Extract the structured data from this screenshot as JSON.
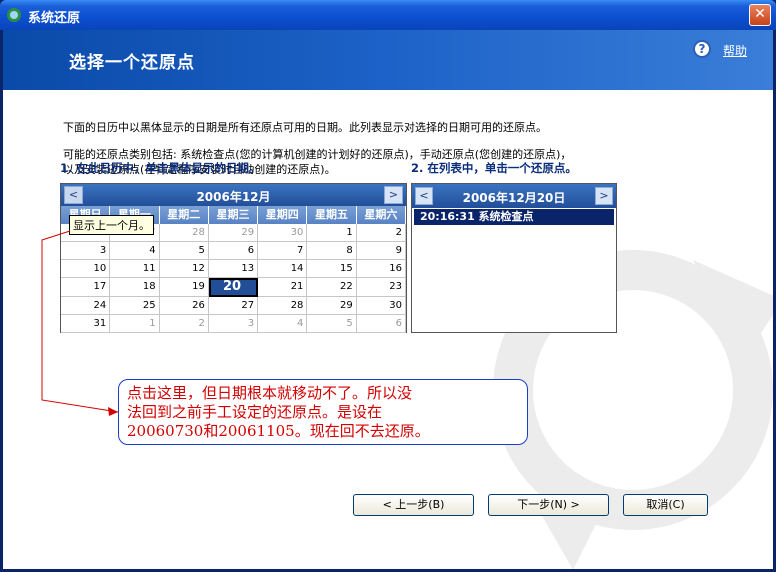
{
  "window": {
    "title": "系统还原",
    "close_glyph": "✕"
  },
  "header": {
    "title": "选择一个还原点",
    "help_label": "帮助"
  },
  "intro": {
    "line1": "下面的日历中以黑体显示的日期是所有还原点可用的日期。此列表显示对选择的日期可用的还原点。",
    "line2": "可能的还原点类别包括: 系统检查点(您的计算机创建的计划好的还原点)，手动还原点(您创建的还原点)，",
    "line3": "以及安装还原点(在特定程序安装时自动创建的还原点)。"
  },
  "step1": "1. 在此日历中，单击黑体显示的日期。",
  "step2": "2. 在列表中，单击一个还原点。",
  "calendar": {
    "month_label": "2006年12月",
    "prev": "<",
    "next": ">",
    "weekdays": [
      "星期日",
      "星期一",
      "星期二",
      "星期三",
      "星期四",
      "星期五",
      "星期六"
    ],
    "weeks": [
      [
        "26",
        "27",
        "28",
        "29",
        "30",
        "1",
        "2"
      ],
      [
        "3",
        "4",
        "5",
        "6",
        "7",
        "8",
        "9"
      ],
      [
        "10",
        "11",
        "12",
        "13",
        "14",
        "15",
        "16"
      ],
      [
        "17",
        "18",
        "19",
        "20",
        "21",
        "22",
        "23"
      ],
      [
        "24",
        "25",
        "26",
        "27",
        "28",
        "29",
        "30"
      ],
      [
        "31",
        "1",
        "2",
        "3",
        "4",
        "5",
        "6"
      ]
    ],
    "selected": "20",
    "tooltip": "显示上一个月。"
  },
  "restore_list": {
    "date_label": "2006年12月20日",
    "prev": "<",
    "next": ">",
    "items": [
      "20:16:31  系统检查点"
    ]
  },
  "annotation": {
    "line1": "点击这里，但日期根本就移动不了。所以没",
    "line2": "法回到之前手工设定的还原点。是设在",
    "line3": "20060730和20061105。现在回不去还原。"
  },
  "buttons": {
    "back": "< 上一步(B)",
    "next": "下一步(N) >",
    "cancel": "取消(C)"
  },
  "colors": {
    "accent": "#0a246a",
    "annotation_text": "#d40000"
  }
}
